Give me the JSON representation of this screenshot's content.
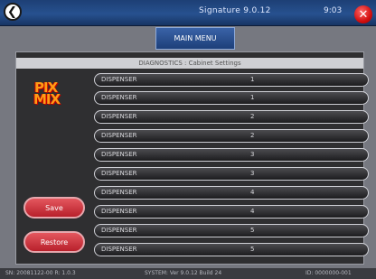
{
  "topbar": {
    "title": "Signature 9.0.12",
    "clock": "9:03"
  },
  "tab": {
    "label": "MAIN MENU"
  },
  "header": {
    "text": "DIAGNOSTICS : Cabinet Settings"
  },
  "logo": {
    "line1": "PIX",
    "line2": "MIX"
  },
  "buttons": {
    "save": "Save",
    "restore": "Restore"
  },
  "rows": [
    {
      "name": "DISPENSER",
      "value": "1"
    },
    {
      "name": "DISPENSER",
      "value": "1"
    },
    {
      "name": "DISPENSER",
      "value": "2"
    },
    {
      "name": "DISPENSER",
      "value": "2"
    },
    {
      "name": "DISPENSER",
      "value": "3"
    },
    {
      "name": "DISPENSER",
      "value": "3"
    },
    {
      "name": "DISPENSER",
      "value": "4"
    },
    {
      "name": "DISPENSER",
      "value": "4"
    },
    {
      "name": "DISPENSER",
      "value": "5"
    },
    {
      "name": "DISPENSER",
      "value": "5"
    }
  ],
  "status": {
    "left": "SN: 20081122-00  R: 1.0.3",
    "middle": "SYSTEM: Ver 9.0.12 Build 24",
    "right": "ID: 0000000-001"
  }
}
